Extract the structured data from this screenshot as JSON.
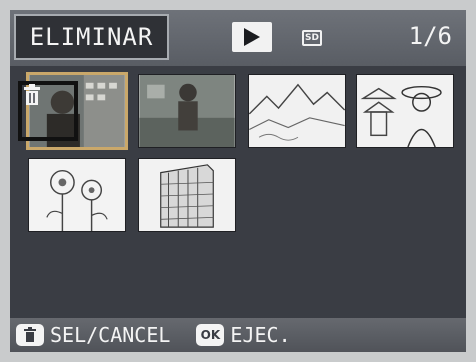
{
  "header": {
    "mode_label": "ELIMINAR",
    "play_icon": "play-icon",
    "card_icon_text": "SD",
    "counter": "1/6"
  },
  "thumbnails": [
    {
      "name": "portrait-with-building",
      "selected": true
    },
    {
      "name": "person-outdoors"
    },
    {
      "name": "mountain-landscape"
    },
    {
      "name": "pagoda-and-woman"
    },
    {
      "name": "flowers-sketch"
    },
    {
      "name": "apartment-building"
    }
  ],
  "footer": {
    "sel_icon": "trash-icon",
    "sel_label": "SEL/CANCEL",
    "ok_icon_text": "OK",
    "ok_label": "EJEC."
  },
  "colors": {
    "screen_bg": "#3a3d44",
    "bar_bg": "#5e6268",
    "selection_frame": "#111111"
  }
}
